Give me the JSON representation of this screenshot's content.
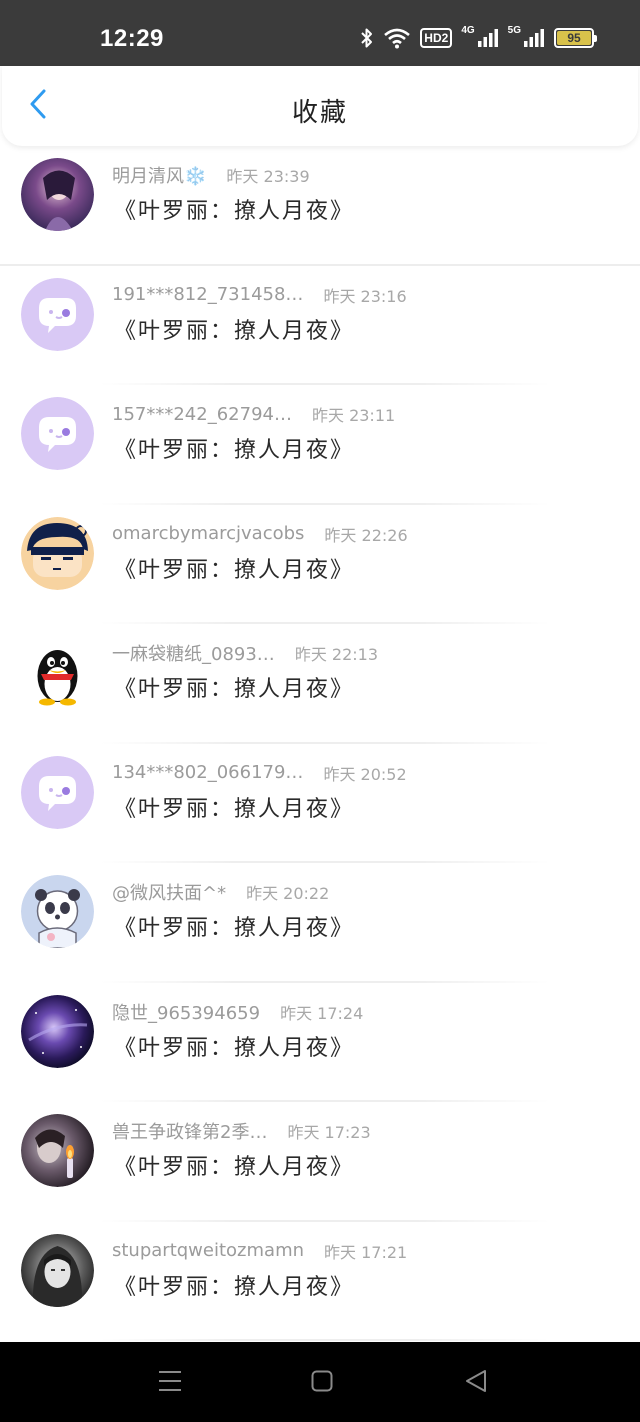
{
  "status_bar": {
    "time": "12:29",
    "hd_label": "HD2",
    "network_1": "4G",
    "network_2": "5G",
    "battery_level": "95",
    "icons": [
      "bluetooth-icon",
      "wifi-icon",
      "signal-icon",
      "battery-icon"
    ]
  },
  "header": {
    "back_icon": "chevron-left-icon",
    "title": "收藏"
  },
  "favorites": [
    {
      "user": "明月清风❄️",
      "time": "昨天 23:39",
      "title": "《叶罗丽：撩人月夜》",
      "avatar": "photo"
    },
    {
      "user": "191***812_731458…",
      "time": "昨天 23:16",
      "title": "《叶罗丽：撩人月夜》",
      "avatar": "default"
    },
    {
      "user": "157***242_62794…",
      "time": "昨天 23:11",
      "title": "《叶罗丽：撩人月夜》",
      "avatar": "default"
    },
    {
      "user": "omarcbymarcjvacobs",
      "time": "昨天 22:26",
      "title": "《叶罗丽：撩人月夜》",
      "avatar": "cartoon"
    },
    {
      "user": "一麻袋糖纸_0893…",
      "time": "昨天 22:13",
      "title": "《叶罗丽：撩人月夜》",
      "avatar": "penguin"
    },
    {
      "user": "134***802_066179…",
      "time": "昨天 20:52",
      "title": "《叶罗丽：撩人月夜》",
      "avatar": "default"
    },
    {
      "user": "@微风扶面^*",
      "time": "昨天 20:22",
      "title": "《叶罗丽：撩人月夜》",
      "avatar": "panda"
    },
    {
      "user": "隐世_965394659",
      "time": "昨天 17:24",
      "title": "《叶罗丽：撩人月夜》",
      "avatar": "galaxy"
    },
    {
      "user": "兽王争政锋第2季…",
      "time": "昨天 17:23",
      "title": "《叶罗丽：撩人月夜》",
      "avatar": "photo-dark"
    },
    {
      "user": "stupartqweitozmamn",
      "time": "昨天 17:21",
      "title": "《叶罗丽：撩人月夜》",
      "avatar": "photo-bw"
    }
  ],
  "nav_bar": {
    "icons": [
      "menu-icon",
      "home-icon",
      "back-icon"
    ]
  },
  "colors": {
    "status_bar": "#3b3b3b",
    "accent": "#2f9bf0",
    "default_avatar": "#d9c9f5",
    "battery": "#d9c24b"
  }
}
